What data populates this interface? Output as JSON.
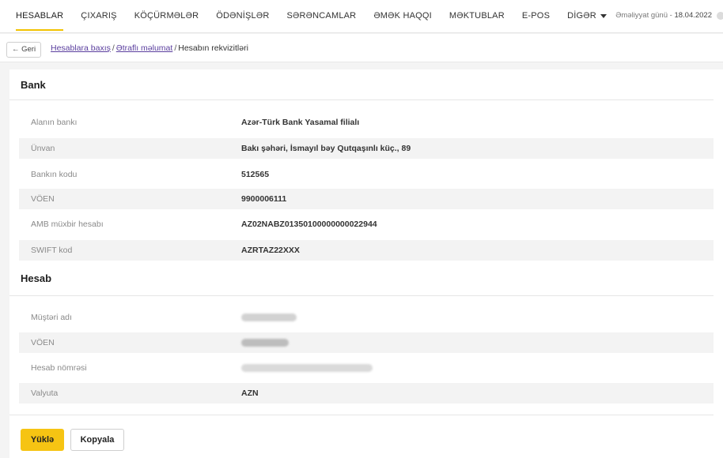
{
  "nav": {
    "items": [
      {
        "label": "HESABLAR",
        "active": true
      },
      {
        "label": "ÇIXARIŞ"
      },
      {
        "label": "KÖÇÜRMƏLƏR"
      },
      {
        "label": "ÖDƏNİŞLƏR"
      },
      {
        "label": "SƏRƏNCAMLAR"
      },
      {
        "label": "ƏMƏK HAQQI"
      },
      {
        "label": "MƏKTUBLAR"
      },
      {
        "label": "E-POS"
      },
      {
        "label": "DİGƏR"
      }
    ],
    "op_day_label": "Əməliyyat günü - ",
    "op_day_date": "18.04.2022"
  },
  "breadcrumb": {
    "back_label": "← Geri",
    "items": [
      "Hesablara baxış",
      "Ətraflı məlumat",
      "Hesabın rekvizitləri"
    ],
    "separator": "/"
  },
  "bank": {
    "title": "Bank",
    "rows": [
      {
        "label": "Alanın bankı",
        "value": "Azər-Türk Bank Yasamal filialı"
      },
      {
        "label": "Ünvan",
        "value": "Bakı şəhəri, İsmayıl bəy Qutqaşınlı küç., 89"
      },
      {
        "label": "Bankın kodu",
        "value": "512565"
      },
      {
        "label": "VÖEN",
        "value": "9900006111"
      },
      {
        "label": "AMB müxbir hesabı",
        "value": "AZ02NABZ01350100000000022944"
      },
      {
        "label": "SWIFT kod",
        "value": "AZRTAZ22XXX"
      }
    ]
  },
  "account": {
    "title": "Hesab",
    "rows": [
      {
        "label": "Müştəri adı",
        "value": ""
      },
      {
        "label": "VÖEN",
        "value": ""
      },
      {
        "label": "Hesab nömrəsi",
        "value": ""
      },
      {
        "label": "Valyuta",
        "value": "AZN"
      }
    ]
  },
  "actions": {
    "download_label": "Yüklə",
    "copy_label": "Kopyala"
  },
  "colors": {
    "accent": "#f6c413",
    "link": "#5a3e9e"
  }
}
